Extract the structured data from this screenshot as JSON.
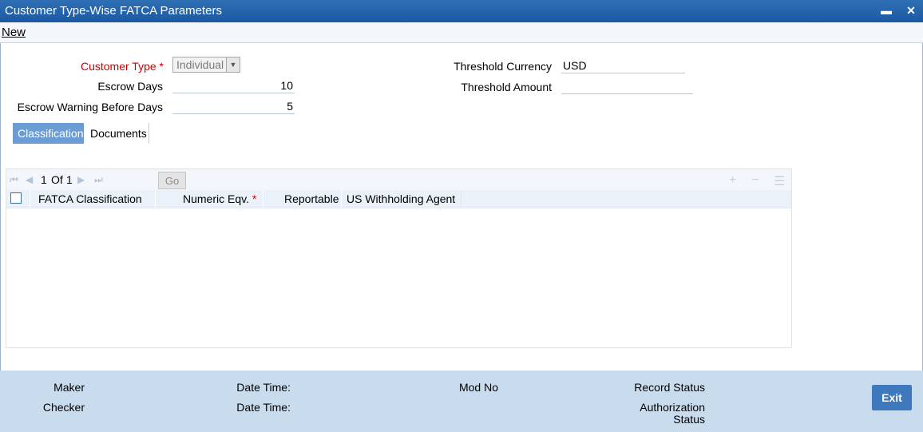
{
  "window": {
    "title": "Customer Type-Wise FATCA Parameters",
    "minimize_glyph": "▬",
    "close_glyph": "✕"
  },
  "menu": {
    "new_label": "New"
  },
  "form": {
    "customer_type_label": "Customer Type",
    "customer_type_value": "Individual",
    "escrow_days_label": "Escrow Days",
    "escrow_days_value": "10",
    "escrow_warning_label": "Escrow Warning Before Days",
    "escrow_warning_value": "5",
    "threshold_currency_label": "Threshold Currency",
    "threshold_currency_value": "USD",
    "threshold_amount_label": "Threshold Amount",
    "threshold_amount_value": "",
    "required_marker": "*"
  },
  "tabs": [
    {
      "label": "Classification",
      "active": true
    },
    {
      "label": "Documents",
      "active": false
    }
  ],
  "grid": {
    "page_current": "1",
    "page_of": "Of",
    "page_total": "1",
    "go_label": "Go",
    "columns": [
      {
        "label": "FATCA Classification"
      },
      {
        "label": "Numeric Eqv."
      },
      {
        "label": "Reportable"
      },
      {
        "label": "US Withholding Agent"
      }
    ],
    "rows": []
  },
  "footer": {
    "maker_label": "Maker",
    "checker_label": "Checker",
    "date_time_label_1": "Date Time:",
    "date_time_label_2": "Date Time:",
    "mod_no_label": "Mod No",
    "record_status_label": "Record Status",
    "authorization_label_1": "Authorization",
    "authorization_label_2": "Status",
    "exit_label": "Exit"
  },
  "colors": {
    "titlebar": "#1b5aa3",
    "active_tab": "#6b9cd6",
    "footer": "#c8dcee",
    "exit_button": "#3e79be",
    "required": "#cc0000"
  }
}
